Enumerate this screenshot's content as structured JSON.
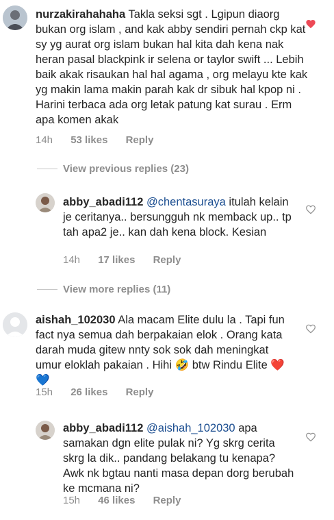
{
  "comments": [
    {
      "username": "nurzakirahahaha",
      "text": "Takla seksi sgt . Lgipun diaorg bukan org islam , and kak abby sendiri pernah ckp kat sy yg aurat org islam bukan hal kita dah kena nak heran pasal blackpink ir selena or taylor swift ... Lebih baik akak risaukan hal hal agama , org melayu kte kak yg makin lama makin parah kak dr sibuk hal kpop ni . Harini terbaca ada org letak patung kat surau . Erm apa komen akak",
      "time": "14h",
      "likes": "53 likes",
      "reply": "Reply",
      "liked": true
    },
    {
      "username": "abby_abadi112",
      "mention": "@chentasuraya",
      "text": "itulah kelain je ceritanya.. bersungguh nk memback up.. tp tah apa2 je.. kan dah kena block. Kesian",
      "time": "14h",
      "likes": "17 likes",
      "reply": "Reply",
      "liked": false
    },
    {
      "username": "aishah_102030",
      "text": "Ala macam Elite dulu la . Tapi fun fact nya semua dah berpakaian elok . Orang kata darah muda gitew nnty sok sok dah meningkat umur eloklah pakaian . Hihi 🤣 btw Rindu Elite ❤️💙",
      "time": "15h",
      "likes": "26 likes",
      "reply": "Reply",
      "liked": false
    },
    {
      "username": "abby_abadi112",
      "mention": "@aishah_102030",
      "text": "apa samakan dgn elite pulak ni? Yg skrg cerita skrg la dik.. pandang belakang tu kenapa? Awk nk bgtau nanti masa depan dorg berubah ke mcmana ni?",
      "time": "15h",
      "likes": "46 likes",
      "reply": "Reply",
      "liked": false
    }
  ],
  "view_previous_replies": "View previous replies (23)",
  "view_more_replies": "View more replies (11)",
  "colors": {
    "heart_liked": "#ed4956",
    "heart_outline": "#8e8e8e",
    "meta": "#8e8e8e",
    "mention": "#1d4f91"
  }
}
